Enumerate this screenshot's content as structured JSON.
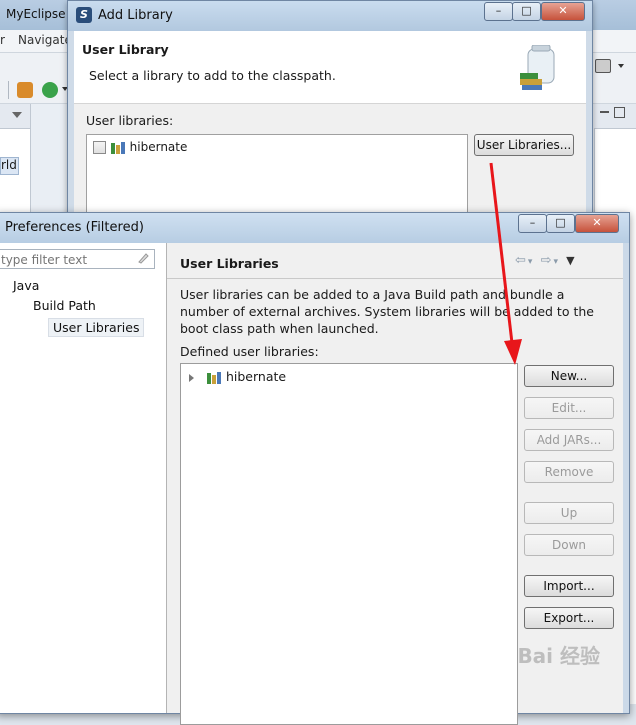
{
  "ide": {
    "title": "MyEclipse",
    "menu": [
      "r",
      "Navigate"
    ],
    "left_pane_text": "rld"
  },
  "add_library": {
    "title": "Add Library",
    "heading": "User Library",
    "description": "Select a library to add to the classpath.",
    "list_label": "User libraries:",
    "items": [
      {
        "label": "hibernate",
        "checked": false
      }
    ],
    "user_libraries_button": "User Libraries..."
  },
  "preferences": {
    "title": "Preferences (Filtered)",
    "filter_placeholder": "type filter text",
    "tree": [
      "Java",
      "Build Path",
      "User Libraries"
    ],
    "page_heading": "User Libraries",
    "description": "User libraries can be added to a Java Build path and bundle a number of external archives. System libraries will be added to the boot class path when launched.",
    "defined_label": "Defined user libraries:",
    "libraries": [
      "hibernate"
    ],
    "buttons": {
      "new": "New...",
      "edit": "Edit...",
      "add_jars": "Add JARs...",
      "remove": "Remove",
      "up": "Up",
      "down": "Down",
      "import": "Import...",
      "export": "Export..."
    }
  },
  "watermark": "Bai 经验",
  "colors": {
    "annotation_arrow": "#e8161b",
    "window_title": "#b7cde3"
  }
}
